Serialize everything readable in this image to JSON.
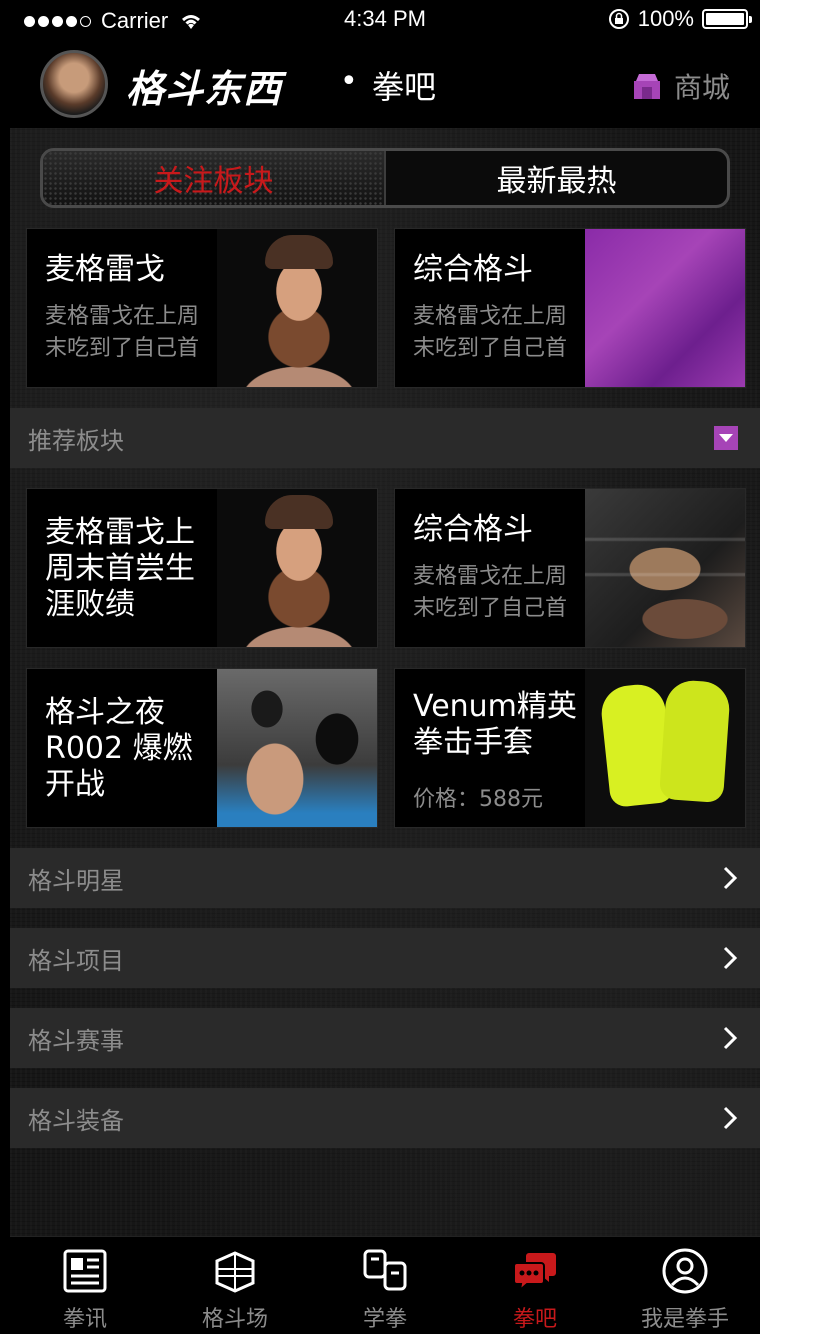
{
  "status_bar": {
    "carrier": "Carrier",
    "time": "4:34 PM",
    "battery": "100%"
  },
  "header": {
    "brand": "格斗东西",
    "separator": "•",
    "section": "拳吧",
    "shop_label": "商城"
  },
  "tabs": [
    {
      "label": "关注板块",
      "active": true
    },
    {
      "label": "最新最热",
      "active": false
    }
  ],
  "followed_cards": [
    {
      "title": "麦格雷戈",
      "desc": "麦格雷戈在上周末吃到了自己首",
      "image": "fighter-portrait"
    },
    {
      "title": "综合格斗",
      "desc": "麦格雷戈在上周末吃到了自己首",
      "image": "mma-purple"
    }
  ],
  "recommended": {
    "label": "推荐板块"
  },
  "recommended_cards": [
    {
      "title": "麦格雷戈上周末首尝生涯败绩",
      "image": "fighter-portrait"
    },
    {
      "title": "综合格斗",
      "desc": "麦格雷戈在上周末吃到了自己首",
      "image": "mma-fight"
    },
    {
      "title": "格斗之夜 R002 爆燃开战",
      "image": "boxing-training"
    },
    {
      "title": "Venum精英拳击手套",
      "price": "价格：588元",
      "image": "venum-gloves"
    }
  ],
  "sections": [
    {
      "label": "格斗明星"
    },
    {
      "label": "格斗项目"
    },
    {
      "label": "格斗赛事"
    },
    {
      "label": "格斗装备"
    }
  ],
  "tabbar": [
    {
      "label": "拳讯",
      "icon": "news-icon",
      "active": false
    },
    {
      "label": "格斗场",
      "icon": "ring-icon",
      "active": false
    },
    {
      "label": "学拳",
      "icon": "learn-icon",
      "active": false
    },
    {
      "label": "拳吧",
      "icon": "chat-icon",
      "active": true
    },
    {
      "label": "我是拳手",
      "icon": "profile-icon",
      "active": false
    }
  ],
  "colors": {
    "accent_red": "#c8191b",
    "muted_text": "#8c8c8c",
    "shop_icon": "#a644b7",
    "section_bg": "#2a2a2a",
    "card_border": "#282828"
  }
}
